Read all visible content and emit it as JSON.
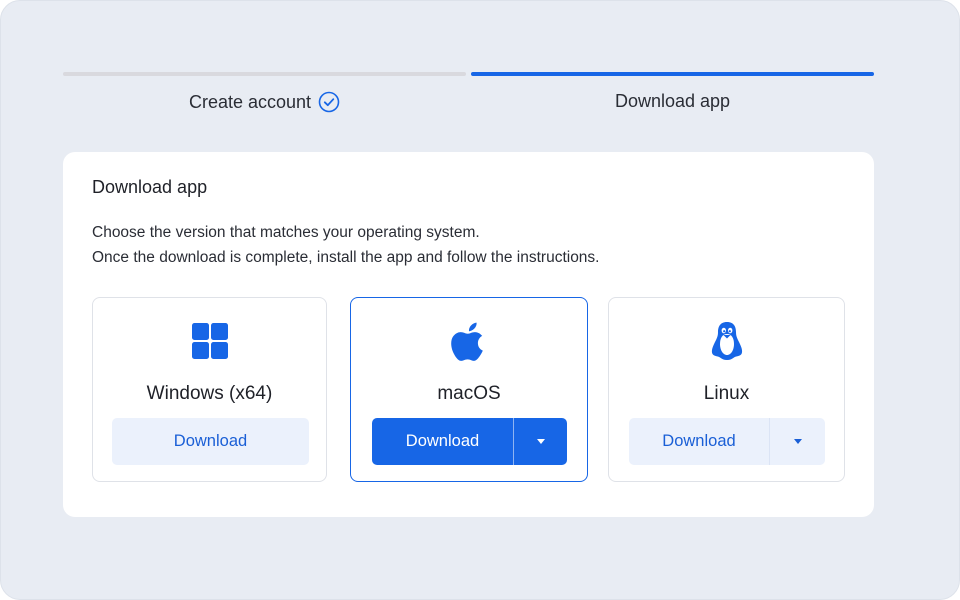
{
  "stepper": {
    "steps": [
      {
        "label": "Create account",
        "state": "complete",
        "icon": "check-circle-icon"
      },
      {
        "label": "Download app",
        "state": "active"
      }
    ]
  },
  "card": {
    "title": "Download app",
    "description_line1": "Choose the version that matches your operating system.",
    "description_line2": "Once the download is complete, install the app and follow the instructions."
  },
  "platforms": [
    {
      "name": "Windows (x64)",
      "icon": "windows-icon",
      "button_label": "Download",
      "selected": false,
      "has_menu": false
    },
    {
      "name": "macOS",
      "icon": "apple-icon",
      "button_label": "Download",
      "selected": true,
      "has_menu": true
    },
    {
      "name": "Linux",
      "icon": "linux-tux-icon",
      "button_label": "Download",
      "selected": false,
      "has_menu": true
    }
  ],
  "colors": {
    "accent": "#1766e6",
    "background": "#e8ecf3",
    "inactive_step": "#d9d9de",
    "light_button": "#ebf1fc"
  }
}
